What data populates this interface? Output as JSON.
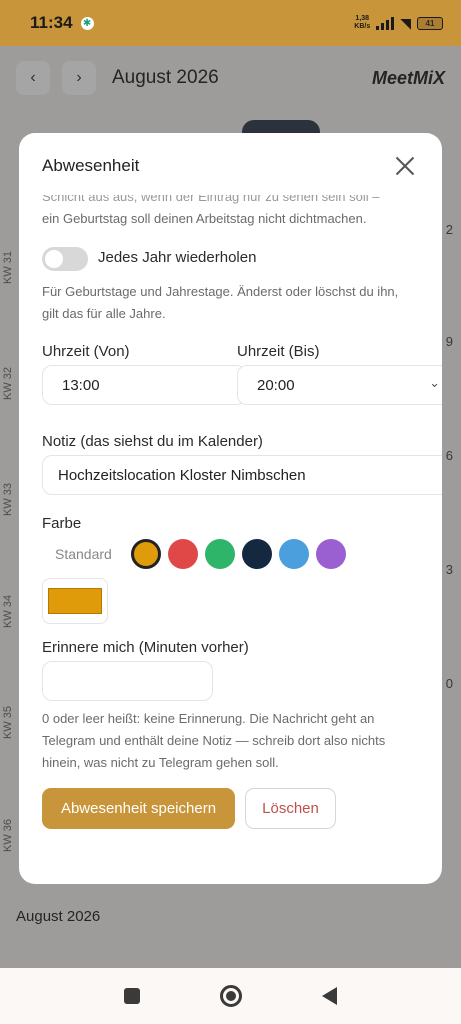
{
  "status_bar": {
    "time": "11:34",
    "net_speed_value": "1,38",
    "net_speed_unit": "KB/s",
    "battery": "41"
  },
  "background": {
    "month_title": "August 2026",
    "prev_icon": "chevron-left-icon",
    "next_icon": "chevron-right-icon",
    "brand": "MeetMiX",
    "week_labels": [
      "KW 31",
      "KW 32",
      "KW 33",
      "KW 34",
      "KW 35",
      "KW 36"
    ],
    "day_numbers": [
      "2",
      "9",
      "6",
      "3",
      "0"
    ],
    "bottom_month": "August 2026"
  },
  "modal": {
    "title": "Abwesenheit",
    "cut_text": "Schicht aus aus, wenn der Eintrag nur zu sehen sein soll –",
    "intro_text": "ein Geburtstag soll deinen Arbeitstag nicht dichtmachen.",
    "repeat_toggle": {
      "label": "Jedes Jahr wiederholen",
      "on": false
    },
    "repeat_help": "Für Geburtstage und Jahrestage. Änderst oder löschst du ihn, gilt das für alle Jahre.",
    "time_from": {
      "label": "Uhrzeit (Von)",
      "value": "13:00"
    },
    "time_to": {
      "label": "Uhrzeit (Bis)",
      "value": "20:00"
    },
    "note": {
      "label": "Notiz (das siehst du im Kalender)",
      "value": "Hochzeitslocation Kloster Nimbschen"
    },
    "color": {
      "label": "Farbe",
      "standard_label": "Standard",
      "swatches": [
        "#e09b0a",
        "#e04848",
        "#2fb56a",
        "#14283f",
        "#4a9fdc",
        "#9a5fd0"
      ],
      "selected_index": 0,
      "custom_value": "#e09b0a"
    },
    "reminder": {
      "label": "Erinnere mich (Minuten vorher)",
      "value": "",
      "help": "0 oder leer heißt: keine Erinnerung. Die Nachricht geht an Telegram und enthält deine Notiz — schreib dort also nichts hinein, was nicht zu Telegram gehen soll."
    },
    "save_label": "Abwesenheit speichern",
    "delete_label": "Löschen"
  }
}
